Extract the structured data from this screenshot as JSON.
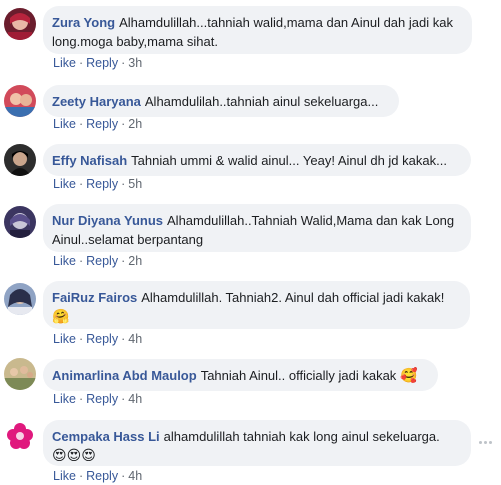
{
  "comments": [
    {
      "author": "Zura Yong",
      "text": "Alhamdulillah...tahniah walid,mama dan Ainul dah jadi kak long.moga baby,mama sihat.",
      "emoji": "",
      "like": "Like",
      "reply": "Reply",
      "time": "3h"
    },
    {
      "author": "Zeety Haryana",
      "text": "Alhamdulilah..tahniah ainul sekeluarga...",
      "emoji": "",
      "like": "Like",
      "reply": "Reply",
      "time": "2h"
    },
    {
      "author": "Effy Nafisah",
      "text": "Tahniah ummi & walid ainul... Yeay! Ainul dh jd kakak...",
      "emoji": "",
      "like": "Like",
      "reply": "Reply",
      "time": "5h"
    },
    {
      "author": "Nur Diyana Yunus",
      "text": "Alhamdulillah..Tahniah Walid,Mama dan kak Long Ainul..selamat berpantang",
      "emoji": "",
      "like": "Like",
      "reply": "Reply",
      "time": "2h"
    },
    {
      "author": "FaiRuz Fairos",
      "text": "Alhamdulillah. Tahniah2. Ainul dah official jadi kakak!",
      "emoji": "🤗",
      "like": "Like",
      "reply": "Reply",
      "time": "4h"
    },
    {
      "author": "Animarlina Abd Maulop",
      "text": "Tahniah Ainul.. officially jadi kakak",
      "emoji": "🥰",
      "like": "Like",
      "reply": "Reply",
      "time": "4h"
    },
    {
      "author": "Cempaka Hass Li",
      "text": "alhamdulillah tahniah kak long ainul sekeluarga.",
      "emoji": "😍😍😍",
      "like": "Like",
      "reply": "Reply",
      "time": "4h"
    }
  ],
  "icons": {
    "more": "more-horizontal-icon"
  },
  "colors": {
    "author": "#385898",
    "bubble": "#f0f2f5",
    "meta": "#606770"
  }
}
